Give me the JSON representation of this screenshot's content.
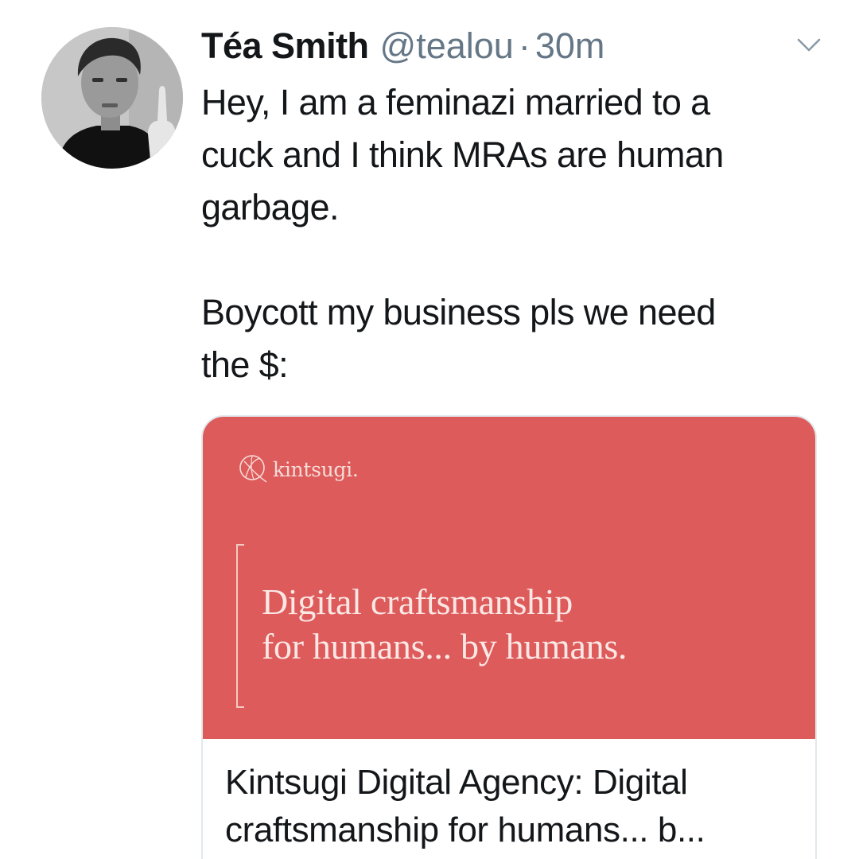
{
  "tweet": {
    "author": {
      "display_name": "Téa Smith",
      "handle": "@tealou",
      "separator": "·",
      "timestamp": "30m"
    },
    "text_paragraphs": [
      "Hey, I am a feminazi married to a\ncuck and I think MRAs are human\ngarbage.",
      "Boycott my business pls we need\nthe $:"
    ],
    "menu_icon": "chevron-down-icon",
    "card": {
      "logo_text": "kintsugi.",
      "tagline": "Digital craftsmanship\nfor humans... by humans.",
      "title": "Kintsugi Digital Agency: Digital\ncraftsmanship for humans... b...",
      "image_color": "#dd5b5b"
    }
  }
}
